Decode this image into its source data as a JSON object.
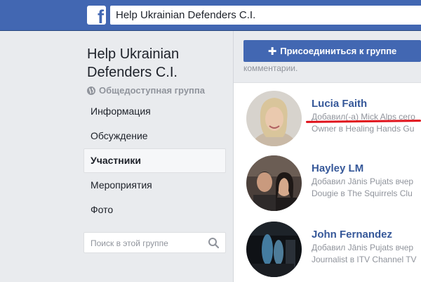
{
  "header": {
    "logo_letter": "f",
    "search_value": "Help Ukrainian Defenders C.I."
  },
  "sidebar": {
    "group_title_line1": "Help Ukrainian",
    "group_title_line2": "Defenders C.I.",
    "group_type": "Общедоступная группа",
    "nav": [
      {
        "label": "Информация"
      },
      {
        "label": "Обсуждение"
      },
      {
        "label": "Участники"
      },
      {
        "label": "Мероприятия"
      },
      {
        "label": "Фото"
      }
    ],
    "search_placeholder": "Поиск в этой группе"
  },
  "main": {
    "join_label": "Присоединиться к группе",
    "comments_text": "комментарии.",
    "members": [
      {
        "name": "Lucia Faith",
        "line1": "Добавил(-а) Mick Alps сего",
        "line2": "Owner в Healing Hands Gu"
      },
      {
        "name": "Hayley LM",
        "line1": "Добавил Jānis Pujats вчер",
        "line2": "Dougie в The Squirrels Clu"
      },
      {
        "name": "John Fernandez",
        "line1": "Добавил Jānis Pujats вчер",
        "line2": "Journalist в ITV Channel TV"
      }
    ]
  },
  "colors": {
    "brand_blue": "#4267b2",
    "link_blue": "#365899",
    "annotation_red": "#e0121b"
  }
}
